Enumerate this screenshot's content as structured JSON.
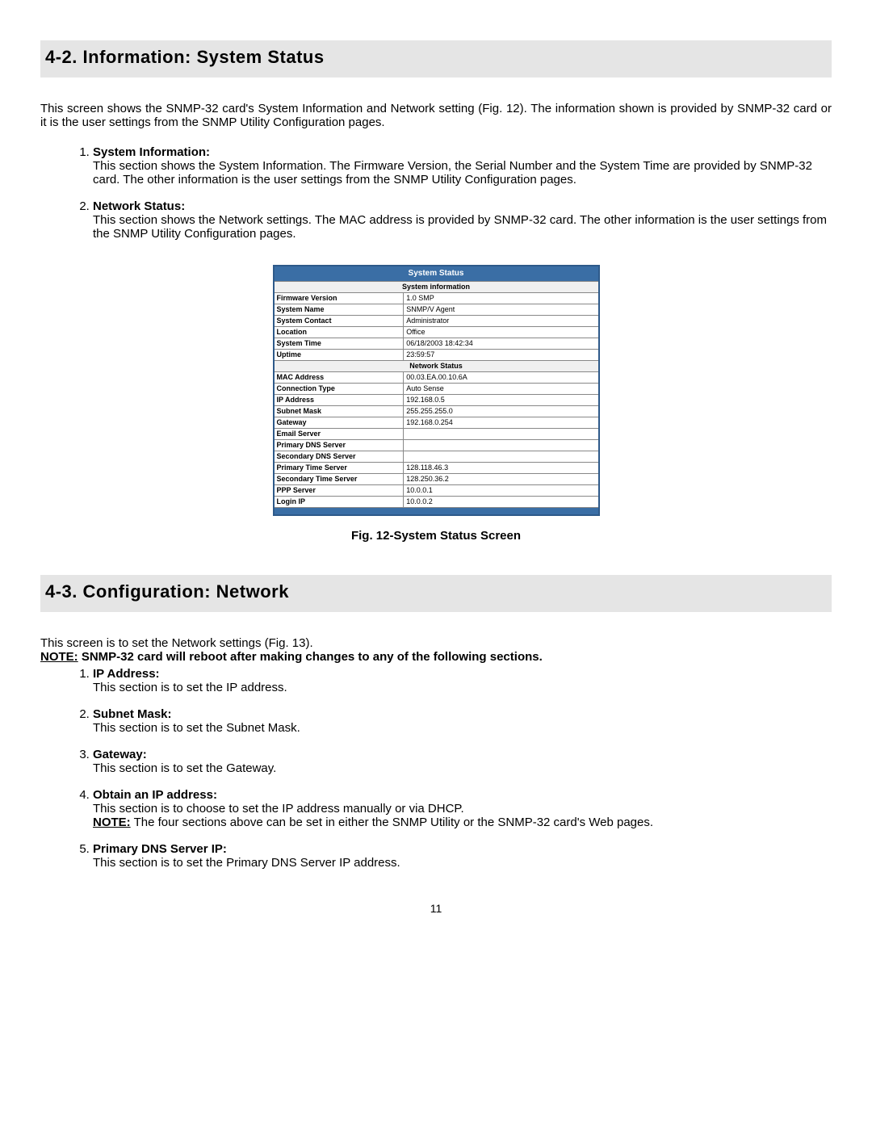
{
  "section42": {
    "title": "4-2. Information: System Status",
    "intro": "This screen shows the SNMP-32 card's System Information and Network setting (Fig. 12).  The information shown is provided by SNMP-32 card or it is the user settings from the SNMP Utility Configuration pages.",
    "items": [
      {
        "title": "System Information:",
        "body": "This section shows the System Information.  The Firmware Version, the Serial Number and the System Time are provided by SNMP-32 card.  The other information is the user settings from the SNMP Utility Configuration pages."
      },
      {
        "title": "Network Status:",
        "body": "This section shows the Network settings.  The MAC address is provided by SNMP-32 card.  The other information is the user settings from the SNMP Utility Configuration pages."
      }
    ]
  },
  "status_table": {
    "main_header": "System Status",
    "sub1": "System information",
    "sys_rows": [
      {
        "l": "Firmware Version",
        "v": "1.0 SMP"
      },
      {
        "l": "System Name",
        "v": "SNMP/V Agent"
      },
      {
        "l": "System Contact",
        "v": "Administrator"
      },
      {
        "l": "Location",
        "v": "Office"
      },
      {
        "l": "System Time",
        "v": "06/18/2003 18:42:34"
      },
      {
        "l": "Uptime",
        "v": "23:59:57"
      }
    ],
    "sub2": "Network Status",
    "net_rows": [
      {
        "l": "MAC Address",
        "v": "00.03.EA.00.10.6A"
      },
      {
        "l": "Connection Type",
        "v": "Auto Sense"
      },
      {
        "l": "IP Address",
        "v": "192.168.0.5"
      },
      {
        "l": "Subnet Mask",
        "v": "255.255.255.0"
      },
      {
        "l": "Gateway",
        "v": "192.168.0.254"
      },
      {
        "l": "Email Server",
        "v": ""
      },
      {
        "l": "Primary DNS Server",
        "v": ""
      },
      {
        "l": "Secondary DNS Server",
        "v": ""
      },
      {
        "l": "Primary Time Server",
        "v": "128.118.46.3"
      },
      {
        "l": "Secondary Time Server",
        "v": "128.250.36.2"
      },
      {
        "l": "PPP Server",
        "v": "10.0.0.1"
      },
      {
        "l": "Login IP",
        "v": "10.0.0.2"
      }
    ]
  },
  "fig12_caption": "Fig. 12-System Status Screen",
  "section43": {
    "title": "4-3. Configuration: Network",
    "intro": "This screen is to set the Network settings (Fig. 13).",
    "note_label": "NOTE:",
    "note_body": "SNMP-32 card will reboot after making changes to any of the following sections.",
    "items": [
      {
        "title": "IP Address:",
        "body": "This section is to set the IP address."
      },
      {
        "title": "Subnet Mask:",
        "body": "This section is to set the Subnet Mask."
      },
      {
        "title": "Gateway:",
        "body": "This section is to set the Gateway."
      },
      {
        "title": "Obtain an IP address:",
        "body": "This section is to choose to set the IP address manually or via DHCP.",
        "note_label": "NOTE:",
        "note_body": "The four sections above can be set in either the SNMP Utility or the SNMP-32 card's Web pages."
      },
      {
        "title": "Primary DNS Server IP:",
        "body": "This section is to set the Primary DNS Server IP address."
      }
    ]
  },
  "page_number": "11"
}
